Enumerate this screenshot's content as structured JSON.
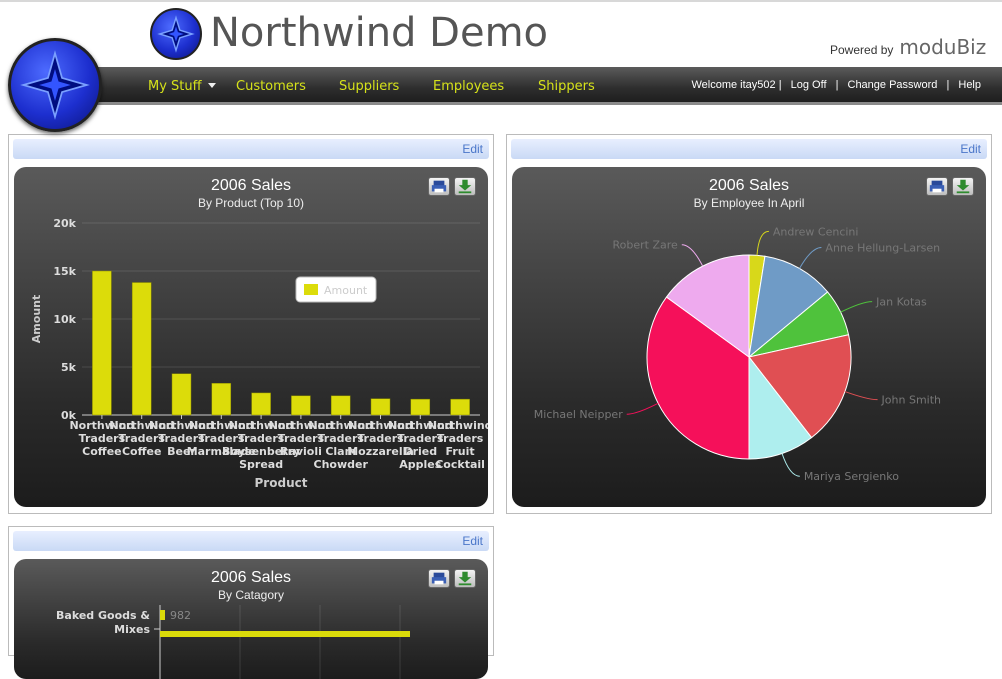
{
  "header": {
    "app_title": "Northwind Demo",
    "powered_by": "Powered by",
    "brand": "moduBiz"
  },
  "nav": {
    "items": [
      "My Stuff",
      "Customers",
      "Suppliers",
      "Employees",
      "Shippers"
    ],
    "welcome": "Welcome itay502 |",
    "log_off": "Log Off",
    "separator": "|",
    "change_password": "Change Password",
    "help": "Help"
  },
  "panels": {
    "edit_label": "Edit"
  },
  "colors": {
    "nav_text": "#d6e21a",
    "bar": "#dcdc0a"
  },
  "chart_data": [
    {
      "type": "bar",
      "title": "2006 Sales",
      "subtitle": "By Product (Top 10)",
      "xlabel": "Product",
      "ylabel": "Amount",
      "ylim": [
        0,
        20000
      ],
      "y_ticks": [
        "0k",
        "5k",
        "10k",
        "15k",
        "20k"
      ],
      "categories": [
        "Northwind Traders Coffee",
        "Northwind Traders Coffee",
        "Northwind Traders Beer",
        "Northwind Traders Marmalade",
        "Northwind Traders Boysenberry Spread",
        "Northwind Traders Ravioli",
        "Northwind Traders Clam Chowder",
        "Northwind Traders Mozzarella",
        "Northwind Traders Dried Apples",
        "Northwind Traders Fruit Cocktail"
      ],
      "series": [
        {
          "name": "Amount",
          "values": [
            15000,
            13800,
            4300,
            3300,
            2300,
            2000,
            2000,
            1700,
            1650,
            1650
          ]
        }
      ],
      "legend": "top-right"
    },
    {
      "type": "pie",
      "title": "2006 Sales",
      "subtitle": "By Employee In April",
      "slices": [
        {
          "label": "Andrew Cencini",
          "value": 2.5,
          "color": "#d8d81a"
        },
        {
          "label": "Anne Hellung-Larsen",
          "value": 11.5,
          "color": "#6f9bc6"
        },
        {
          "label": "Jan Kotas",
          "value": 7.5,
          "color": "#4fc23c"
        },
        {
          "label": "John Smith",
          "value": 18.0,
          "color": "#e04f53"
        },
        {
          "label": "Mariya Sergienko",
          "value": 10.5,
          "color": "#aeeeee"
        },
        {
          "label": "Michael Neipper",
          "value": 35.0,
          "color": "#f5105a"
        },
        {
          "label": "Robert Zare",
          "value": 15.0,
          "color": "#eeaaee"
        }
      ]
    },
    {
      "type": "bar",
      "title": "2006 Sales",
      "subtitle": "By Catagory",
      "categories": [
        "Baked Goods & Mixes"
      ],
      "series": [
        {
          "values": [
            982
          ]
        }
      ]
    }
  ]
}
